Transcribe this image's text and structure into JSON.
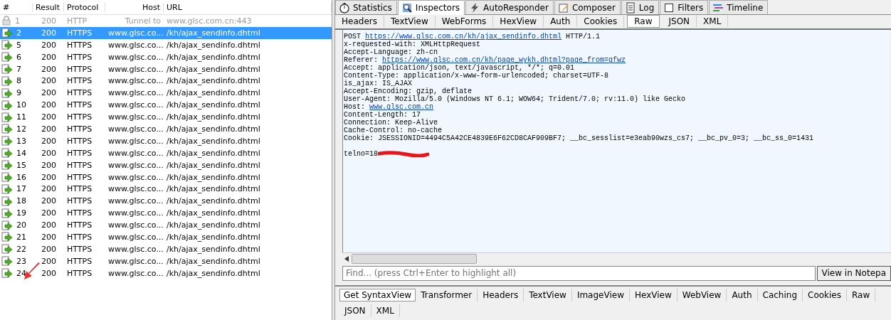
{
  "session_list": {
    "columns": [
      "#",
      "Result",
      "Protocol",
      "Host",
      "URL"
    ],
    "rows": [
      {
        "kind": "tunnel",
        "num": "1",
        "result": "200",
        "protocol": "HTTP",
        "host": "Tunnel to",
        "url": "www.glsc.com.cn:443",
        "selected": false
      },
      {
        "kind": "request",
        "num": "2",
        "result": "200",
        "protocol": "HTTPS",
        "host": "www.glsc.co...",
        "url": "/kh/ajax_sendinfo.dhtml",
        "selected": true
      },
      {
        "kind": "request",
        "num": "5",
        "result": "200",
        "protocol": "HTTPS",
        "host": "www.glsc.co...",
        "url": "/kh/ajax_sendinfo.dhtml",
        "selected": false
      },
      {
        "kind": "request",
        "num": "6",
        "result": "200",
        "protocol": "HTTPS",
        "host": "www.glsc.co...",
        "url": "/kh/ajax_sendinfo.dhtml",
        "selected": false
      },
      {
        "kind": "request",
        "num": "7",
        "result": "200",
        "protocol": "HTTPS",
        "host": "www.glsc.co...",
        "url": "/kh/ajax_sendinfo.dhtml",
        "selected": false
      },
      {
        "kind": "request",
        "num": "8",
        "result": "200",
        "protocol": "HTTPS",
        "host": "www.glsc.co...",
        "url": "/kh/ajax_sendinfo.dhtml",
        "selected": false
      },
      {
        "kind": "request",
        "num": "9",
        "result": "200",
        "protocol": "HTTPS",
        "host": "www.glsc.co...",
        "url": "/kh/ajax_sendinfo.dhtml",
        "selected": false
      },
      {
        "kind": "request",
        "num": "10",
        "result": "200",
        "protocol": "HTTPS",
        "host": "www.glsc.co...",
        "url": "/kh/ajax_sendinfo.dhtml",
        "selected": false
      },
      {
        "kind": "request",
        "num": "11",
        "result": "200",
        "protocol": "HTTPS",
        "host": "www.glsc.co...",
        "url": "/kh/ajax_sendinfo.dhtml",
        "selected": false
      },
      {
        "kind": "request",
        "num": "12",
        "result": "200",
        "protocol": "HTTPS",
        "host": "www.glsc.co...",
        "url": "/kh/ajax_sendinfo.dhtml",
        "selected": false
      },
      {
        "kind": "request",
        "num": "13",
        "result": "200",
        "protocol": "HTTPS",
        "host": "www.glsc.co...",
        "url": "/kh/ajax_sendinfo.dhtml",
        "selected": false
      },
      {
        "kind": "request",
        "num": "14",
        "result": "200",
        "protocol": "HTTPS",
        "host": "www.glsc.co...",
        "url": "/kh/ajax_sendinfo.dhtml",
        "selected": false
      },
      {
        "kind": "request",
        "num": "15",
        "result": "200",
        "protocol": "HTTPS",
        "host": "www.glsc.co...",
        "url": "/kh/ajax_sendinfo.dhtml",
        "selected": false
      },
      {
        "kind": "request",
        "num": "16",
        "result": "200",
        "protocol": "HTTPS",
        "host": "www.glsc.co...",
        "url": "/kh/ajax_sendinfo.dhtml",
        "selected": false
      },
      {
        "kind": "request",
        "num": "17",
        "result": "200",
        "protocol": "HTTPS",
        "host": "www.glsc.co...",
        "url": "/kh/ajax_sendinfo.dhtml",
        "selected": false
      },
      {
        "kind": "request",
        "num": "18",
        "result": "200",
        "protocol": "HTTPS",
        "host": "www.glsc.co...",
        "url": "/kh/ajax_sendinfo.dhtml",
        "selected": false
      },
      {
        "kind": "request",
        "num": "19",
        "result": "200",
        "protocol": "HTTPS",
        "host": "www.glsc.co...",
        "url": "/kh/ajax_sendinfo.dhtml",
        "selected": false
      },
      {
        "kind": "request",
        "num": "20",
        "result": "200",
        "protocol": "HTTPS",
        "host": "www.glsc.co...",
        "url": "/kh/ajax_sendinfo.dhtml",
        "selected": false
      },
      {
        "kind": "request",
        "num": "21",
        "result": "200",
        "protocol": "HTTPS",
        "host": "www.glsc.co...",
        "url": "/kh/ajax_sendinfo.dhtml",
        "selected": false
      },
      {
        "kind": "request",
        "num": "22",
        "result": "200",
        "protocol": "HTTPS",
        "host": "www.glsc.co...",
        "url": "/kh/ajax_sendinfo.dhtml",
        "selected": false
      },
      {
        "kind": "request",
        "num": "23",
        "result": "200",
        "protocol": "HTTPS",
        "host": "www.glsc.co...",
        "url": "/kh/ajax_sendinfo.dhtml",
        "selected": false
      },
      {
        "kind": "request",
        "num": "24",
        "result": "200",
        "protocol": "HTTPS",
        "host": "www.glsc.co...",
        "url": "/kh/ajax_sendinfo.dhtml",
        "selected": false
      }
    ]
  },
  "main_tabs": [
    {
      "kind": "stopwatch",
      "label": "Statistics",
      "selected": false
    },
    {
      "kind": "inspect",
      "label": "Inspectors",
      "selected": true
    },
    {
      "kind": "bolt",
      "label": "AutoResponder",
      "selected": false
    },
    {
      "kind": "pencil",
      "label": "Composer",
      "selected": false
    },
    {
      "kind": "log",
      "label": "Log",
      "selected": false
    },
    {
      "kind": "box",
      "label": "Filters",
      "selected": false
    },
    {
      "kind": "timeline",
      "label": "Timeline",
      "selected": false
    }
  ],
  "request_tabs": [
    {
      "label": "Headers",
      "selected": false
    },
    {
      "label": "TextView",
      "selected": false
    },
    {
      "label": "WebForms",
      "selected": false
    },
    {
      "label": "HexView",
      "selected": false
    },
    {
      "label": "Auth",
      "selected": false
    },
    {
      "label": "Cookies",
      "selected": false
    },
    {
      "label": "Raw",
      "selected": true
    },
    {
      "label": "JSON",
      "selected": false
    },
    {
      "label": "XML",
      "selected": false
    }
  ],
  "raw_lines": [
    {
      "parts": [
        {
          "text": "POST ",
          "link": false
        },
        {
          "text": "https://www.glsc.com.cn/kh/ajax_sendinfo.dhtml",
          "link": true
        },
        {
          "text": " HTTP/1.1",
          "link": false
        }
      ]
    },
    {
      "parts": [
        {
          "text": "x-requested-with: XMLHttpRequest",
          "link": false
        }
      ]
    },
    {
      "parts": [
        {
          "text": "Accept-Language: zh-cn",
          "link": false
        }
      ]
    },
    {
      "parts": [
        {
          "text": "Referer: ",
          "link": false
        },
        {
          "text": "https://www.glsc.com.cn/kh/page_wykh.dhtml?page_from=gfwz",
          "link": true
        }
      ]
    },
    {
      "parts": [
        {
          "text": "Accept: application/json, text/javascript, */*; q=0.01",
          "link": false
        }
      ]
    },
    {
      "parts": [
        {
          "text": "Content-Type: application/x-www-form-urlencoded; charset=UTF-8",
          "link": false
        }
      ]
    },
    {
      "parts": [
        {
          "text": "is_ajax: IS_AJAX",
          "link": false
        }
      ]
    },
    {
      "parts": [
        {
          "text": "Accept-Encoding: gzip, deflate",
          "link": false
        }
      ]
    },
    {
      "parts": [
        {
          "text": "User-Agent: Mozilla/5.0 (Windows NT 6.1; WOW64; Trident/7.0; rv:11.0) like Gecko",
          "link": false
        }
      ]
    },
    {
      "parts": [
        {
          "text": "Host: ",
          "link": false
        },
        {
          "text": "www.glsc.com.cn",
          "link": true
        }
      ]
    },
    {
      "parts": [
        {
          "text": "Content-Length: 17",
          "link": false
        }
      ]
    },
    {
      "parts": [
        {
          "text": "Connection: Keep-Alive",
          "link": false
        }
      ]
    },
    {
      "parts": [
        {
          "text": "Cache-Control: no-cache",
          "link": false
        }
      ]
    },
    {
      "parts": [
        {
          "text": "Cookie: JSESSIONID=4494C5A42CE4839E6F62CD8CAF909BF7; __bc_sesslist=e3eab90wzs_cs7; __bc_pv_0=3; __bc_ss_0=1431",
          "link": false
        }
      ]
    },
    {
      "parts": [
        {
          "text": "telno=18",
          "link": false
        }
      ],
      "redacted": true,
      "space_before": true
    }
  ],
  "find": {
    "placeholder": "Find... (press Ctrl+Enter to highlight all)"
  },
  "view_button": "View in Notepa",
  "response_tabs": [
    {
      "label": "Get SyntaxView",
      "selected": true
    },
    {
      "label": "Transformer",
      "selected": false
    },
    {
      "label": "Headers",
      "selected": false
    },
    {
      "label": "TextView",
      "selected": false
    },
    {
      "label": "ImageView",
      "selected": false
    },
    {
      "label": "HexView",
      "selected": false
    },
    {
      "label": "WebView",
      "selected": false
    },
    {
      "label": "Auth",
      "selected": false
    },
    {
      "label": "Caching",
      "selected": false
    },
    {
      "label": "Cookies",
      "selected": false
    },
    {
      "label": "Raw",
      "selected": false
    },
    {
      "label": "JSON",
      "selected": false
    },
    {
      "label": "XML",
      "selected": false
    }
  ]
}
